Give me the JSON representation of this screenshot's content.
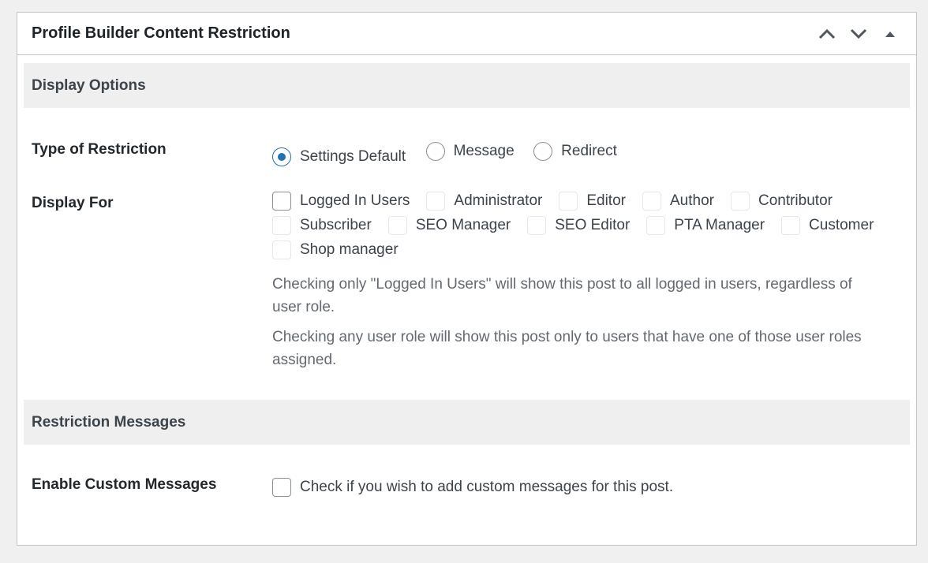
{
  "panel": {
    "title": "Profile Builder Content Restriction",
    "icons": [
      "chevron-up-icon",
      "chevron-down-icon",
      "triangle-up-icon"
    ]
  },
  "display_options": {
    "heading": "Display Options",
    "type_of_restriction": {
      "label": "Type of Restriction",
      "options": [
        "Settings Default",
        "Message",
        "Redirect"
      ],
      "selected": "Settings Default"
    },
    "display_for": {
      "label": "Display For",
      "row1": [
        "Logged In Users",
        "Administrator",
        "Editor",
        "Author",
        "Contributor"
      ],
      "row2": [
        "Subscriber",
        "SEO Manager",
        "SEO Editor",
        "PTA Manager",
        "Customer"
      ],
      "row3": [
        "Shop manager"
      ],
      "help1": "Checking only \"Logged In Users\" will show this post to all logged in users, regardless of user role.",
      "help2": "Checking any user role will show this post only to users that have one of those user roles assigned."
    }
  },
  "restriction_messages": {
    "heading": "Restriction Messages",
    "enable_custom": {
      "label": "Enable Custom Messages",
      "checkbox_label": "Check if you wish to add custom messages for this post."
    }
  },
  "colors": {
    "accent": "#2271b1",
    "section_bg": "#efefef",
    "page_bg": "#f0f0f1"
  }
}
